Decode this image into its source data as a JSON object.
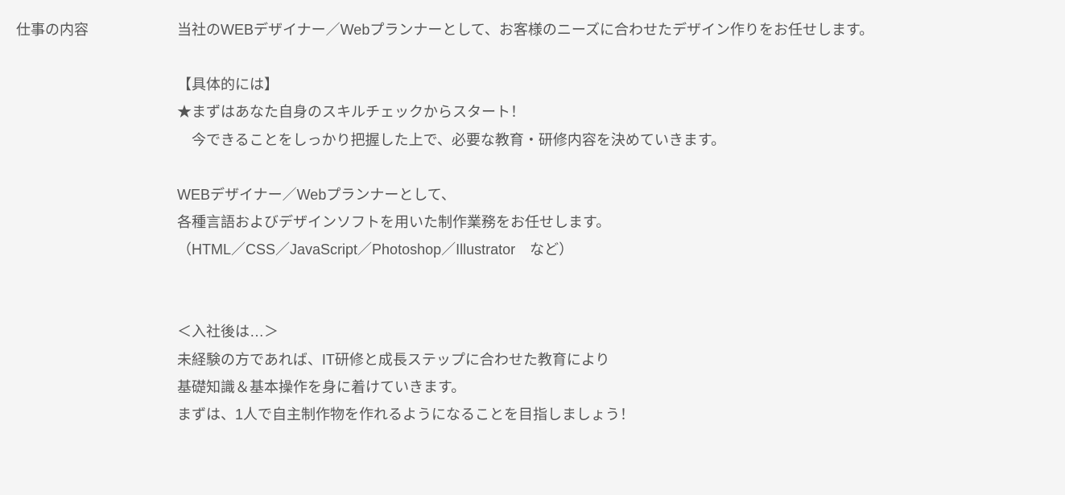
{
  "label": "仕事の内容",
  "content": {
    "p1": {
      "l1": "当社のWEBデザイナー／Webプランナーとして、お客様のニーズに合わせたデザイン作りをお任せします。"
    },
    "p2": {
      "l1": "【具体的には】",
      "l2": "★まずはあなた自身のスキルチェックからスタート！",
      "l3": "　今できることをしっかり把握した上で、必要な教育・研修内容を決めていきます。"
    },
    "p3": {
      "l1": "WEBデザイナー／Webプランナーとして、",
      "l2": "各種言語およびデザインソフトを用いた制作業務をお任せします。",
      "l3": "（HTML／CSS／JavaScript／Photoshop／Illustrator　など）"
    },
    "p4": {
      "l1": "＜入社後は…＞",
      "l2": "未経験の方であれば、IT研修と成長ステップに合わせた教育により",
      "l3": "基礎知識＆基本操作を身に着けていきます。",
      "l4": "まずは、1人で自主制作物を作れるようになることを目指しましょう！"
    }
  }
}
